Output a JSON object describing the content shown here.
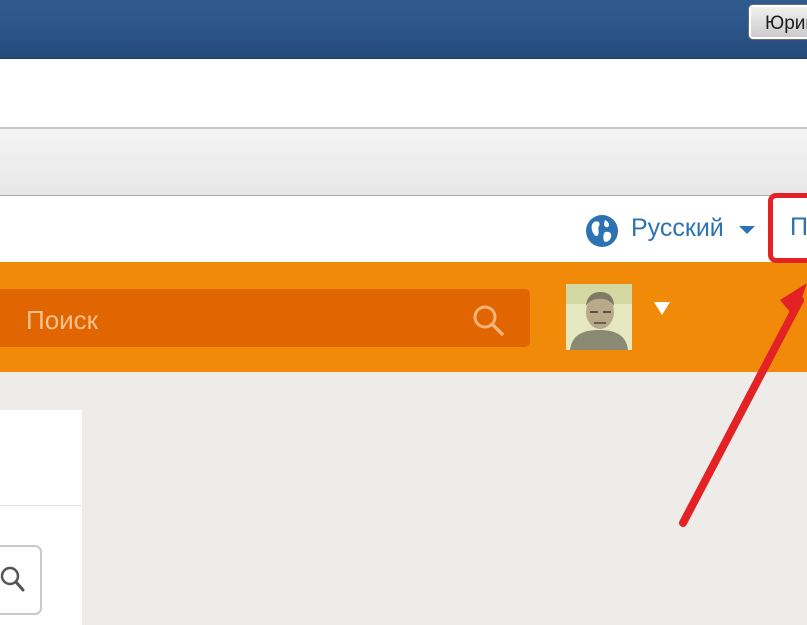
{
  "os_taskbar": {
    "user_button_label": "Юрий"
  },
  "header": {
    "language_label": "Русский",
    "login_link": "П"
  },
  "toolbar": {
    "search_placeholder": "Поиск"
  },
  "icons": {
    "globe": "globe-icon",
    "search": "search-icon",
    "avatar": "user-avatar",
    "dropdown": "chevron-down-icon"
  },
  "colors": {
    "toolbar_orange": "#f18a08",
    "search_orange": "#e16500",
    "link_blue": "#2d73b4",
    "annotation_red": "#e32226"
  }
}
